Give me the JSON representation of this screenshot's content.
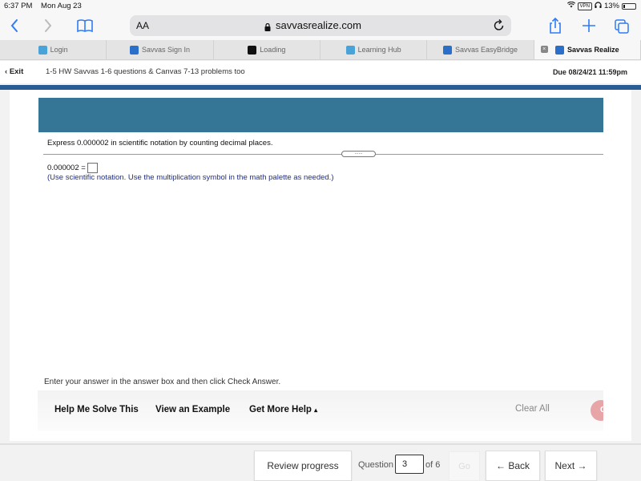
{
  "status_bar": {
    "time": "6:37 PM",
    "date": "Mon Aug 23",
    "vpn_label": "VPN",
    "battery": "13%",
    "battery_fraction": 0.13
  },
  "browser": {
    "text_size_label": "AA",
    "url": "savvasrealize.com",
    "icons": [
      "back-icon",
      "forward-icon",
      "bookmarks-icon",
      "lock-icon",
      "reload-icon",
      "share-icon",
      "new-tab-icon",
      "tabs-icon"
    ]
  },
  "tabs": [
    {
      "label": "Login",
      "icon": "cloud-icon",
      "active": false
    },
    {
      "label": "Savvas Sign In",
      "icon": "savvas-icon",
      "active": false
    },
    {
      "label": "Loading",
      "icon": "b-icon",
      "active": false
    },
    {
      "label": "Learning Hub",
      "icon": "cloud-icon",
      "active": false
    },
    {
      "label": "Savvas EasyBridge",
      "icon": "savvas-icon",
      "active": false
    },
    {
      "label": "Savvas Realize",
      "icon": "savvas-icon",
      "active": true
    }
  ],
  "header": {
    "exit_label": "Exit",
    "assignment_title": "1-5 HW Savvas 1-6 questions & Canvas 7-13 problems too",
    "due": "Due 08/24/21 11:59pm"
  },
  "question": {
    "prompt": "Express 0.000002 in scientific notation by counting decimal places.",
    "grip_dots": "......",
    "equation_lhs": "0.000002 =",
    "answer_value": "",
    "hint": "(Use scientific notation. Use the multiplication symbol in the math palette as needed.)",
    "instruction": "Enter your answer in the answer box and then click Check Answer."
  },
  "help_bar": {
    "help_me_solve": "Help Me Solve This",
    "view_example": "View an Example",
    "get_more_help": "Get More Help",
    "get_more_help_caret": "▴",
    "clear_all": "Clear All",
    "check_label": "C"
  },
  "footer": {
    "review_progress": "Review progress",
    "question_label": "Question",
    "question_number": "3",
    "of_label": "of 6",
    "go_label": "Go",
    "back_label": "← Back",
    "next_label": "Next →"
  },
  "colors": {
    "banner": "#357595",
    "blue_bar": "#2b5d95",
    "hint_text": "#1e2d8a",
    "check_button": "#e8a5a8",
    "safari_accent": "#2f7cf6"
  }
}
